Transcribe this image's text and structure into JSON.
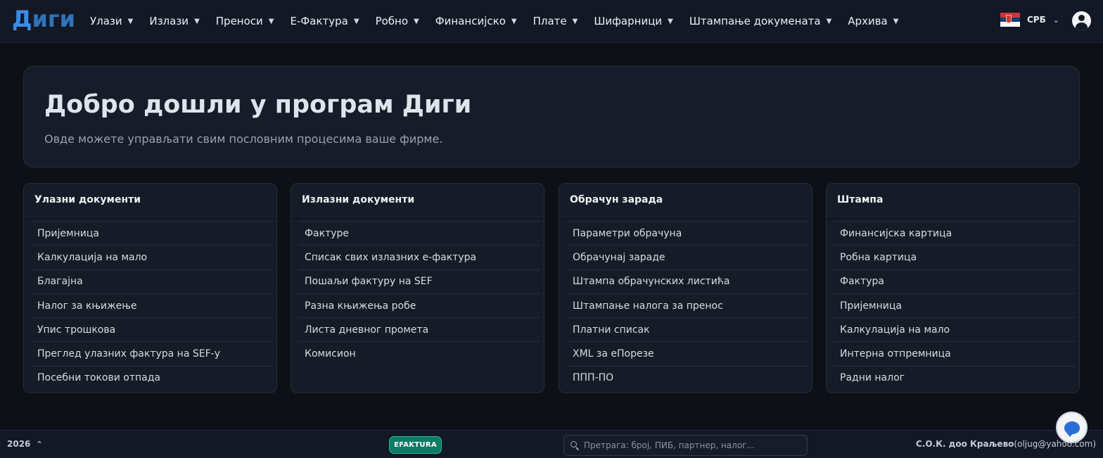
{
  "app": {
    "logo": "Диги"
  },
  "nav": {
    "items": [
      {
        "label": "Улази"
      },
      {
        "label": "Излази"
      },
      {
        "label": "Преноси"
      },
      {
        "label": "Е-Фактура"
      },
      {
        "label": "Робно"
      },
      {
        "label": "Финансијско"
      },
      {
        "label": "Плате"
      },
      {
        "label": "Шифарници"
      },
      {
        "label": "Штампање докумената"
      },
      {
        "label": "Архива"
      }
    ],
    "caret_icon": "triangle-down-icon",
    "language": {
      "code": "СРБ",
      "flag_icon": "serbia-flag-icon"
    },
    "user_icon": "user-circle-icon"
  },
  "hero": {
    "title": "Добро дошли у програм Диги",
    "subtitle": "Овде можете управљати свим пословним процесима ваше фирме."
  },
  "cards": [
    {
      "title": "Улазни документи",
      "links": [
        "Пријемница",
        "Калкулација на мало",
        "Благајна",
        "Налог за књижење",
        "Упис трошкова",
        "Преглед улазних фактура на SEF-у",
        "Посебни токови отпада"
      ]
    },
    {
      "title": "Излазни документи",
      "links": [
        "Фактуре",
        "Списак свих излазних е-фактура",
        "Пошаљи фактуру на SEF",
        "Разна књижења робе",
        "Листа дневног промета",
        "Комисион"
      ]
    },
    {
      "title": "Обрачун зарада",
      "links": [
        "Параметри обрачуна",
        "Обрачунај зараде",
        "Штампа обрачунских листића",
        "Штампање налога за пренос",
        "Платни списак",
        "XML за еПорезе",
        "ППП-ПО"
      ]
    },
    {
      "title": "Штампа",
      "links": [
        "Финансијска картица",
        "Робна картица",
        "Фактура",
        "Пријемница",
        "Калкулација на мало",
        "Интерна отпремница",
        "Радни налог"
      ]
    }
  ],
  "footer": {
    "year": "2026",
    "badge": "EFAKTURA",
    "search_placeholder": "Претрага: број, ПИБ, партнер, налог...",
    "company_name": "С.О.К. доо Краљево",
    "company_email": "(oljug@yahoo.com)"
  },
  "colors": {
    "background": "#0d1017",
    "panel": "#161c2a",
    "accent": "#3b8ce6",
    "badge": "#0f7a66"
  },
  "chat_icon": "chat-bubble-icon"
}
